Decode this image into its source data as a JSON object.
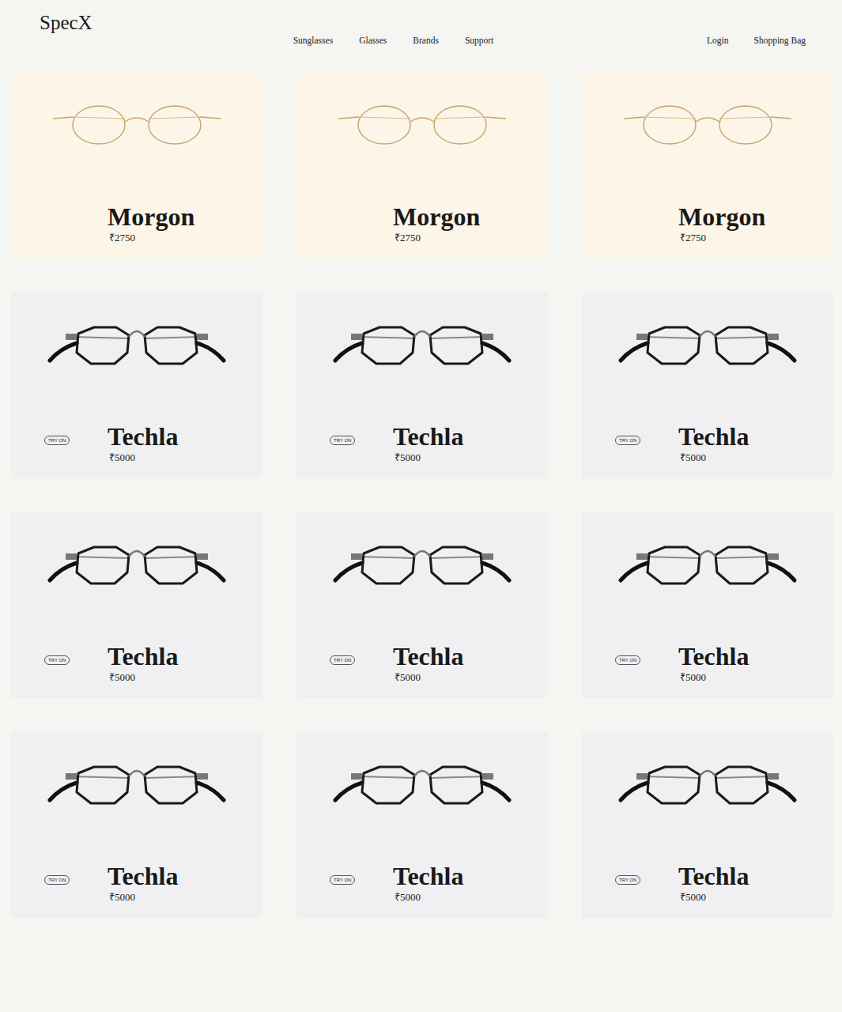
{
  "header": {
    "logo": "SpecX",
    "nav": [
      "Sunglasses",
      "Glasses",
      "Brands",
      "Support"
    ],
    "actions": [
      "Login",
      "Shopping Bag"
    ]
  },
  "products": [
    {
      "name": "Morgon",
      "price": "₹2750",
      "kind": "basic"
    },
    {
      "name": "Morgon",
      "price": "₹2750",
      "kind": "basic"
    },
    {
      "name": "Morgon",
      "price": "₹2750",
      "kind": "basic"
    },
    {
      "name": "Techla",
      "price": "₹5000",
      "kind": "try-on",
      "button": "TRY ON"
    },
    {
      "name": "Techla",
      "price": "₹5000",
      "kind": "try-on",
      "button": "TRY ON"
    },
    {
      "name": "Techla",
      "price": "₹5000",
      "kind": "try-on",
      "button": "TRY ON"
    },
    {
      "name": "Techla",
      "price": "₹5000",
      "kind": "try-on",
      "button": "TRY ON"
    },
    {
      "name": "Techla",
      "price": "₹5000",
      "kind": "try-on",
      "button": "TRY ON"
    },
    {
      "name": "Techla",
      "price": "₹5000",
      "kind": "try-on",
      "button": "TRY ON"
    },
    {
      "name": "Techla",
      "price": "₹5000",
      "kind": "try-on",
      "button": "TRY ON"
    },
    {
      "name": "Techla",
      "price": "₹5000",
      "kind": "try-on",
      "button": "TRY ON"
    },
    {
      "name": "Techla",
      "price": "₹5000",
      "kind": "try-on",
      "button": "TRY ON"
    }
  ]
}
